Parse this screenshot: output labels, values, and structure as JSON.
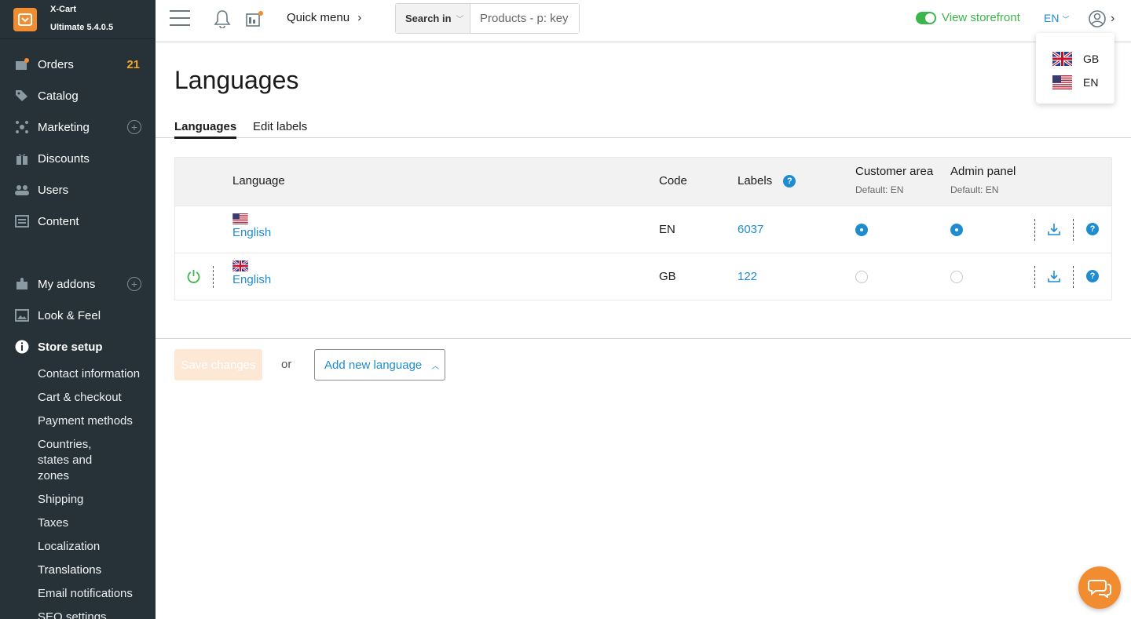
{
  "brand": {
    "name": "X-Cart",
    "edition": "Ultimate 5.4.0.5"
  },
  "sidebar": {
    "items": [
      {
        "label": "Orders",
        "icon": "orders-icon",
        "badge": "21"
      },
      {
        "label": "Catalog",
        "icon": "tag-icon"
      },
      {
        "label": "Marketing",
        "icon": "marketing-icon"
      },
      {
        "label": "Discounts",
        "icon": "gift-icon"
      },
      {
        "label": "Users",
        "icon": "users-icon"
      },
      {
        "label": "Content",
        "icon": "content-icon"
      },
      {
        "label": "My addons",
        "icon": "puzzle-icon"
      },
      {
        "label": "Look & Feel",
        "icon": "image-icon"
      },
      {
        "label": "Store setup",
        "icon": "info-icon"
      }
    ],
    "store_setup_sub": [
      "Contact information",
      "Cart & checkout",
      "Payment methods",
      "Countries, states and zones",
      "Shipping",
      "Taxes",
      "Localization",
      "Translations",
      "Email notifications",
      "SEO settings"
    ]
  },
  "topbar": {
    "quick_menu": "Quick menu",
    "search_in": "Search in",
    "search_placeholder": "Products - p: key",
    "view_storefront": "View storefront",
    "language": "EN"
  },
  "lang_dropdown": [
    {
      "code": "GB",
      "flag": "uk-flag"
    },
    {
      "code": "EN",
      "flag": "us-flag"
    }
  ],
  "page": {
    "title": "Languages",
    "tabs": [
      "Languages",
      "Edit labels"
    ]
  },
  "table": {
    "headers": {
      "language": "Language",
      "code": "Code",
      "labels": "Labels",
      "customer_area": "Customer area",
      "customer_default": "Default: EN",
      "admin_panel": "Admin panel",
      "admin_default": "Default: EN"
    },
    "rows": [
      {
        "name": "English",
        "flag": "us-flag",
        "code": "EN",
        "labels": "6037",
        "customer_default": true,
        "admin_default": true
      },
      {
        "name": "English",
        "flag": "uk-flag",
        "code": "GB",
        "labels": "122",
        "customer_default": false,
        "admin_default": false
      }
    ]
  },
  "footer": {
    "save_label": "Save changes",
    "or": "or",
    "add_label": "Add new language"
  },
  "colors": {
    "accent": "#1e8cd1",
    "brand": "#f28c30",
    "sidebar": "#263238",
    "success": "#3cb54a"
  }
}
